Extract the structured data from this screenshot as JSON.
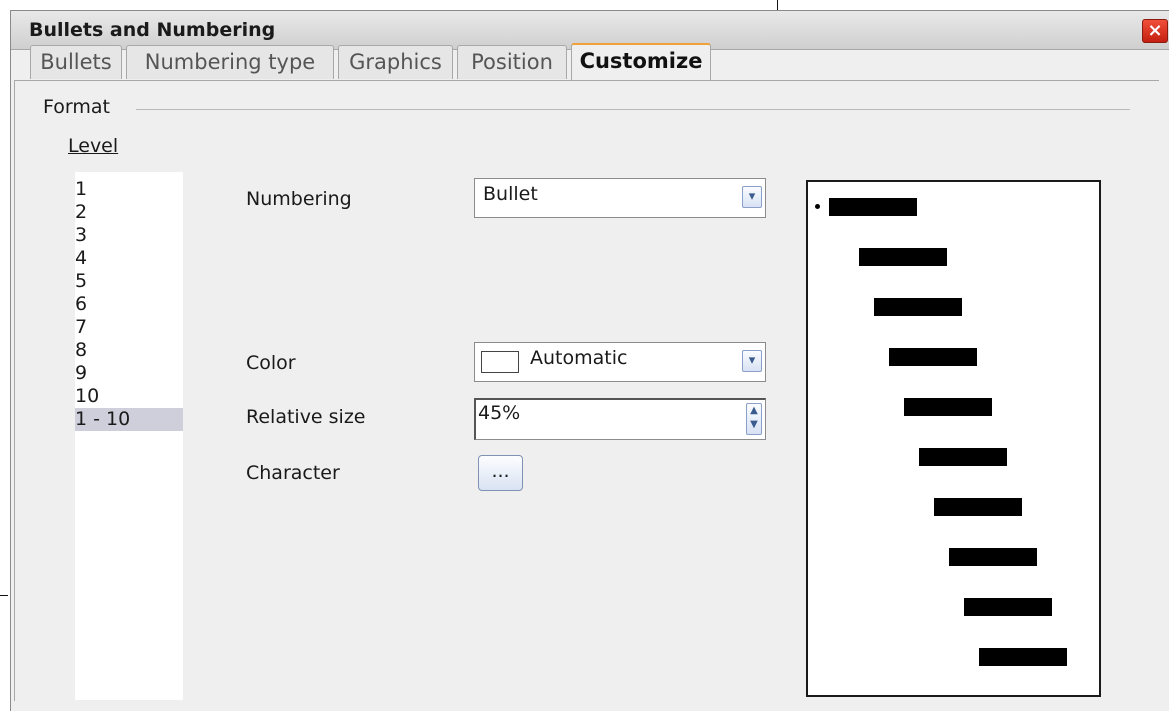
{
  "window": {
    "title": "Bullets and Numbering",
    "close_glyph": "×"
  },
  "tabs": [
    {
      "label": "Bullets",
      "active": false
    },
    {
      "label": "Numbering type",
      "active": false
    },
    {
      "label": "Graphics",
      "active": false
    },
    {
      "label": "Position",
      "active": false
    },
    {
      "label": "Customize",
      "active": true
    }
  ],
  "format": {
    "section_label": "Format",
    "level_label": "Level",
    "levels": [
      "1",
      "2",
      "3",
      "4",
      "5",
      "6",
      "7",
      "8",
      "9",
      "10",
      "1 - 10"
    ],
    "selected_level": "1 - 10"
  },
  "fields": {
    "numbering": {
      "label": "Numbering",
      "value": "Bullet"
    },
    "color": {
      "label": "Color",
      "value": "Automatic",
      "swatch": "#ffffff"
    },
    "relative_size": {
      "label": "Relative size",
      "value": "45%"
    },
    "character": {
      "label": "Character",
      "button_label": "..."
    }
  },
  "preview": {
    "bullet_glyph": "•",
    "levels": 10
  },
  "colors": {
    "active_tab_accent": "#f0a13a",
    "selection": "#cfcfdc",
    "close": "#d8331f"
  },
  "icons": {
    "combo_arrow": "chevron-down-icon",
    "spin": "spin-up-down-icon",
    "close": "close-icon"
  }
}
